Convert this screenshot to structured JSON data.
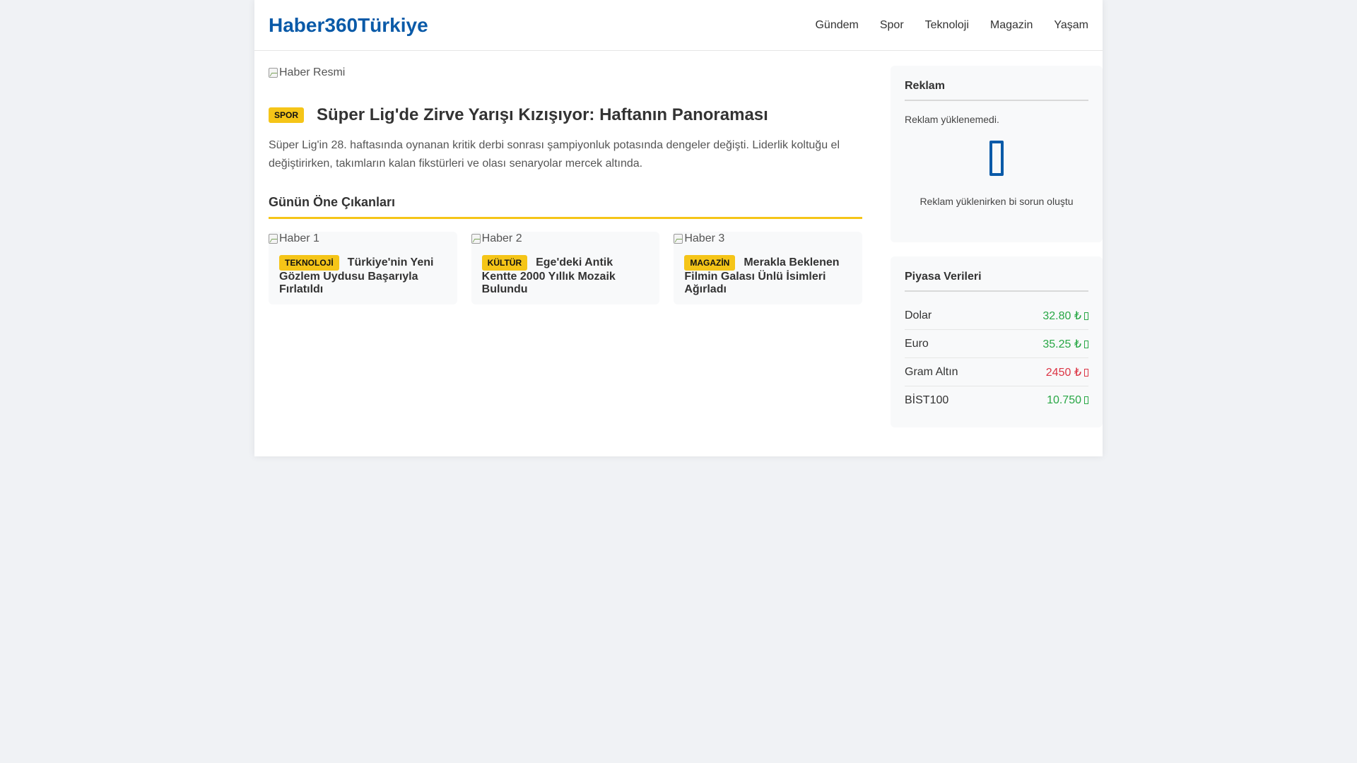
{
  "site": {
    "logo": "Haber360Türkiye"
  },
  "nav": [
    {
      "label": "Gündem"
    },
    {
      "label": "Spor"
    },
    {
      "label": "Teknoloji"
    },
    {
      "label": "Magazin"
    },
    {
      "label": "Yaşam"
    }
  ],
  "hero": {
    "image_alt": "Haber Resmi",
    "category": "SPOR",
    "title": "Süper Lig'de Zirve Yarışı Kızışıyor: Haftanın Panoraması",
    "summary": "Süper Lig'in 28. haftasında oynanan kritik derbi sonrası şampiyonluk potasında dengeler değişti. Liderlik koltuğu el değiştirirken, takımların kalan fikstürleri ve olası senaryolar mercek altında."
  },
  "highlights": {
    "title": "Günün Öne Çıkanları",
    "cards": [
      {
        "image_alt": "Haber 1",
        "category": "TEKNOLOJİ",
        "title": "Türkiye'nin Yeni Gözlem Uydusu Başarıyla Fırlatıldı"
      },
      {
        "image_alt": "Haber 2",
        "category": "KÜLTÜR",
        "title": "Ege'deki Antik Kentte 2000 Yıllık Mozaik Bulundu"
      },
      {
        "image_alt": "Haber 3",
        "category": "MAGAZİN",
        "title": "Merakla Beklenen Filmin Galası Ünlü İsimleri Ağırladı"
      }
    ]
  },
  "ad": {
    "title": "Reklam",
    "message": "Reklam yüklenemedi.",
    "icon": "missing-glyph-icon",
    "error": "Reklam yüklenirken bi sorun oluştu"
  },
  "market": {
    "title": "Piyasa Verileri",
    "items": [
      {
        "name": "Dolar",
        "value": "32.80 ₺",
        "trend": "up"
      },
      {
        "name": "Euro",
        "value": "35.25 ₺",
        "trend": "up"
      },
      {
        "name": "Gram Altın",
        "value": "2450 ₺",
        "trend": "down"
      },
      {
        "name": "BİST100",
        "value": "10.750",
        "trend": "up"
      }
    ]
  },
  "colors": {
    "brand": "#0a5aa8",
    "accent": "#f5c518",
    "up": "#28a745",
    "down": "#dc3545",
    "background": "#f0f2f5"
  }
}
